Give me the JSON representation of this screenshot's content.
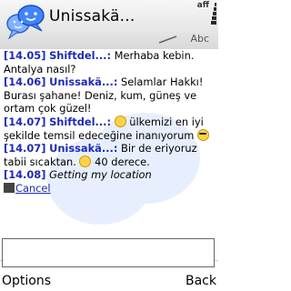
{
  "header": {
    "title": "Unissakä...",
    "status_text": "aff",
    "input_mode": "Abc"
  },
  "messages": [
    {
      "time": "[14.05]",
      "sender": "Shiftdel...:",
      "text": "Merhaba kebin. Antalya nasıl?"
    },
    {
      "time": "[14.06]",
      "sender": "Unissakä...:",
      "text": "Selamlar Hakkı! Burası şahane! Deniz, kum, güneş ve ortam çok güzel!"
    },
    {
      "time": "[14.07]",
      "sender": "Shiftdel...:",
      "text_before": "ülkemizi en iyi şekilde temsil edeceğine inanıyorum",
      "emoji_1": "smiley-icon",
      "emoji_2": "sunglasses-icon"
    },
    {
      "time": "[14.07]",
      "sender": "Unissakä...:",
      "text_before": "Bir de eriyoruz tabii sıcaktan.",
      "text_after": "40 derece.",
      "emoji": "smiley-icon"
    },
    {
      "time": "[14.08]",
      "status": "Getting my location"
    }
  ],
  "location": {
    "cancel_label": "Cancel"
  },
  "softkeys": {
    "left": "Options",
    "right": "Back"
  }
}
